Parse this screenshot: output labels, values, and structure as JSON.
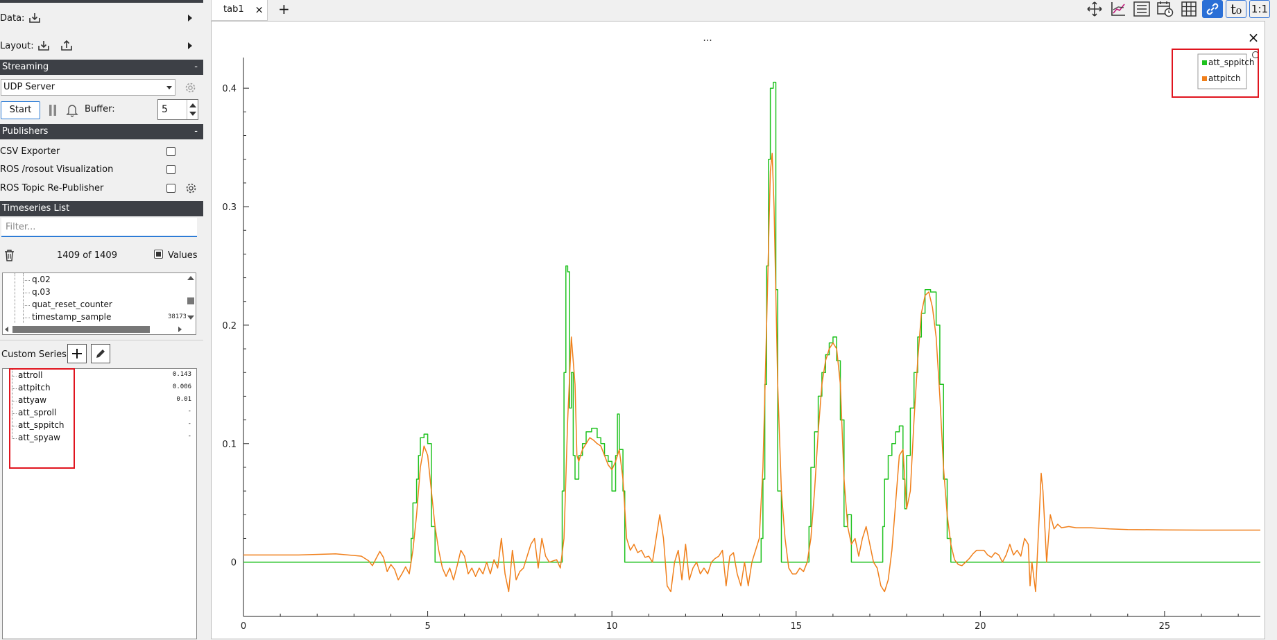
{
  "left": {
    "data_label": "Data:",
    "layout_label": "Layout:",
    "streaming": {
      "header": "Streaming",
      "collapse": "-",
      "source": "UDP Server",
      "start_label": "Start",
      "buffer_label": "Buffer:",
      "buffer_value": "5"
    },
    "publishers": {
      "header": "Publishers",
      "collapse": "-",
      "items": [
        {
          "label": "CSV Exporter"
        },
        {
          "label": "ROS /rosout Visualization"
        },
        {
          "label": "ROS Topic Re-Publisher"
        }
      ]
    },
    "timeseries": {
      "header": "Timeseries List",
      "filter_placeholder": "Filter...",
      "count": "1409 of 1409",
      "values_label": "Values",
      "tree_items": [
        "q.02",
        "q.03",
        "quat_reset_counter",
        "timestamp_sample"
      ],
      "timestamp_value": "38173"
    },
    "custom_series": {
      "label": "Custom Series:",
      "items": [
        {
          "name": "attroll",
          "value": "0.143"
        },
        {
          "name": "attpitch",
          "value": "0.006"
        },
        {
          "name": "attyaw",
          "value": "0.01"
        },
        {
          "name": "att_sproll",
          "value": "-"
        },
        {
          "name": "att_sppitch",
          "value": "-"
        },
        {
          "name": "att_spyaw",
          "value": "-"
        }
      ]
    }
  },
  "tabs": [
    {
      "label": "tab1",
      "close": "×"
    }
  ],
  "add_tab": "+",
  "toolbar": {
    "ratio_label": "1:1",
    "t0_label": "t₀"
  },
  "plot": {
    "title": "...",
    "close": "×"
  },
  "chart_data": {
    "type": "line",
    "xlim": [
      0,
      27.6
    ],
    "ylim": [
      -0.04,
      0.42
    ],
    "xticks": [
      0,
      5,
      10,
      15,
      20,
      25
    ],
    "yticks": [
      0,
      0.1,
      0.2,
      0.3,
      0.4
    ],
    "ytick_labels": [
      "0",
      "0.1",
      "0.2",
      "0.3",
      "0.4"
    ],
    "grid": false,
    "legend_position": "top-right",
    "series": [
      {
        "name": "att_sppitch",
        "color": "#1fc21f",
        "step": true,
        "points": [
          [
            0,
            0
          ],
          [
            4.5,
            0
          ],
          [
            4.55,
            0.02
          ],
          [
            4.6,
            0.05
          ],
          [
            4.7,
            0.07
          ],
          [
            4.75,
            0.09
          ],
          [
            4.8,
            0.105
          ],
          [
            4.9,
            0.108
          ],
          [
            5.0,
            0.1
          ],
          [
            5.1,
            0.03
          ],
          [
            5.2,
            0
          ],
          [
            8.6,
            0
          ],
          [
            8.65,
            0.06
          ],
          [
            8.7,
            0.16
          ],
          [
            8.75,
            0.25
          ],
          [
            8.8,
            0.245
          ],
          [
            8.85,
            0.13
          ],
          [
            8.9,
            0.16
          ],
          [
            8.95,
            0.09
          ],
          [
            9.0,
            0.07
          ],
          [
            9.1,
            0.09
          ],
          [
            9.2,
            0.1
          ],
          [
            9.3,
            0.11
          ],
          [
            9.45,
            0.113
          ],
          [
            9.6,
            0.105
          ],
          [
            9.7,
            0.1
          ],
          [
            9.8,
            0.09
          ],
          [
            9.9,
            0.085
          ],
          [
            10.0,
            0.06
          ],
          [
            10.1,
            0.09
          ],
          [
            10.15,
            0.125
          ],
          [
            10.2,
            0.095
          ],
          [
            10.3,
            0.06
          ],
          [
            10.35,
            0
          ],
          [
            14.0,
            0
          ],
          [
            14.05,
            0.02
          ],
          [
            14.1,
            0.07
          ],
          [
            14.15,
            0.15
          ],
          [
            14.2,
            0.25
          ],
          [
            14.25,
            0.34
          ],
          [
            14.3,
            0.4
          ],
          [
            14.38,
            0.405
          ],
          [
            14.45,
            0.23
          ],
          [
            14.5,
            0.06
          ],
          [
            14.6,
            0
          ],
          [
            15.3,
            0
          ],
          [
            15.35,
            0.03
          ],
          [
            15.4,
            0.08
          ],
          [
            15.5,
            0.11
          ],
          [
            15.6,
            0.14
          ],
          [
            15.7,
            0.16
          ],
          [
            15.8,
            0.175
          ],
          [
            15.9,
            0.185
          ],
          [
            16.0,
            0.19
          ],
          [
            16.1,
            0.17
          ],
          [
            16.2,
            0.12
          ],
          [
            16.3,
            0.03
          ],
          [
            16.4,
            0.04
          ],
          [
            16.5,
            0
          ],
          [
            17.3,
            0
          ],
          [
            17.35,
            0.03
          ],
          [
            17.4,
            0.07
          ],
          [
            17.5,
            0.09
          ],
          [
            17.6,
            0.1
          ],
          [
            17.7,
            0.11
          ],
          [
            17.8,
            0.115
          ],
          [
            17.9,
            0.07
          ],
          [
            17.95,
            0.045
          ],
          [
            18.0,
            0.09
          ],
          [
            18.1,
            0.13
          ],
          [
            18.2,
            0.16
          ],
          [
            18.3,
            0.19
          ],
          [
            18.4,
            0.21
          ],
          [
            18.5,
            0.23
          ],
          [
            18.65,
            0.228
          ],
          [
            18.8,
            0.2
          ],
          [
            18.9,
            0.15
          ],
          [
            19.0,
            0.07
          ],
          [
            19.1,
            0.02
          ],
          [
            19.2,
            0
          ],
          [
            27.6,
            0
          ]
        ]
      },
      {
        "name": "attpitch",
        "color": "#f07f1a",
        "step": false,
        "points": [
          [
            0,
            0.006
          ],
          [
            1.5,
            0.006
          ],
          [
            2.5,
            0.007
          ],
          [
            3.2,
            0.005
          ],
          [
            3.4,
            0.001
          ],
          [
            3.5,
            -0.003
          ],
          [
            3.6,
            0.003
          ],
          [
            3.7,
            0.009
          ],
          [
            3.8,
            0.004
          ],
          [
            3.9,
            -0.008
          ],
          [
            4.0,
            -0.002
          ],
          [
            4.1,
            -0.006
          ],
          [
            4.2,
            -0.015
          ],
          [
            4.3,
            -0.01
          ],
          [
            4.4,
            -0.004
          ],
          [
            4.5,
            -0.01
          ],
          [
            4.6,
            0.01
          ],
          [
            4.7,
            0.04
          ],
          [
            4.8,
            0.08
          ],
          [
            4.9,
            0.098
          ],
          [
            5.0,
            0.09
          ],
          [
            5.1,
            0.06
          ],
          [
            5.2,
            0.03
          ],
          [
            5.3,
            0.01
          ],
          [
            5.4,
            -0.005
          ],
          [
            5.5,
            -0.012
          ],
          [
            5.6,
            -0.005
          ],
          [
            5.7,
            -0.015
          ],
          [
            5.8,
            -0.003
          ],
          [
            5.9,
            0.01
          ],
          [
            6.0,
            0.005
          ],
          [
            6.1,
            -0.01
          ],
          [
            6.2,
            -0.005
          ],
          [
            6.3,
            -0.012
          ],
          [
            6.4,
            -0.005
          ],
          [
            6.5,
            -0.01
          ],
          [
            6.6,
            0.0
          ],
          [
            6.7,
            -0.01
          ],
          [
            6.8,
            0.002
          ],
          [
            6.9,
            -0.005
          ],
          [
            7.0,
            0.02
          ],
          [
            7.1,
            -0.01
          ],
          [
            7.2,
            -0.025
          ],
          [
            7.3,
            0.01
          ],
          [
            7.4,
            -0.015
          ],
          [
            7.5,
            -0.008
          ],
          [
            7.6,
            -0.005
          ],
          [
            7.7,
            0.005
          ],
          [
            7.8,
            0.015
          ],
          [
            7.9,
            0.02
          ],
          [
            8.0,
            -0.005
          ],
          [
            8.1,
            0.02
          ],
          [
            8.2,
            0.005
          ],
          [
            8.3,
            0.0
          ],
          [
            8.5,
            0.002
          ],
          [
            8.6,
            -0.005
          ],
          [
            8.7,
            0.02
          ],
          [
            8.8,
            0.12
          ],
          [
            8.9,
            0.19
          ],
          [
            9.0,
            0.15
          ],
          [
            9.05,
            0.09
          ],
          [
            9.1,
            0.085
          ],
          [
            9.2,
            0.095
          ],
          [
            9.3,
            0.1
          ],
          [
            9.4,
            0.105
          ],
          [
            9.5,
            0.103
          ],
          [
            9.6,
            0.1
          ],
          [
            9.7,
            0.098
          ],
          [
            9.8,
            0.09
          ],
          [
            9.9,
            0.082
          ],
          [
            10.0,
            0.078
          ],
          [
            10.1,
            0.085
          ],
          [
            10.2,
            0.095
          ],
          [
            10.3,
            0.07
          ],
          [
            10.4,
            0.02
          ],
          [
            10.5,
            0.01
          ],
          [
            10.6,
            0.015
          ],
          [
            10.7,
            0.008
          ],
          [
            10.8,
            0.01
          ],
          [
            10.9,
            0.004
          ],
          [
            11.0,
            0.005
          ],
          [
            11.1,
            0.0
          ],
          [
            11.2,
            0.02
          ],
          [
            11.3,
            0.04
          ],
          [
            11.4,
            0.02
          ],
          [
            11.5,
            -0.02
          ],
          [
            11.6,
            -0.025
          ],
          [
            11.7,
            0.0
          ],
          [
            11.8,
            0.01
          ],
          [
            11.9,
            -0.015
          ],
          [
            12.0,
            0.015
          ],
          [
            12.1,
            -0.015
          ],
          [
            12.2,
            -0.005
          ],
          [
            12.3,
            0.0
          ],
          [
            12.4,
            -0.01
          ],
          [
            12.5,
            -0.005
          ],
          [
            12.6,
            -0.01
          ],
          [
            12.7,
            0.0
          ],
          [
            12.8,
            0.003
          ],
          [
            12.9,
            0.005
          ],
          [
            13.0,
            0.01
          ],
          [
            13.1,
            -0.02
          ],
          [
            13.2,
            0.005
          ],
          [
            13.3,
            0.008
          ],
          [
            13.4,
            -0.01
          ],
          [
            13.5,
            -0.02
          ],
          [
            13.6,
            0.0
          ],
          [
            13.7,
            -0.02
          ],
          [
            13.8,
            0.0
          ],
          [
            13.9,
            0.01
          ],
          [
            14.0,
            0.02
          ],
          [
            14.1,
            0.08
          ],
          [
            14.2,
            0.2
          ],
          [
            14.3,
            0.33
          ],
          [
            14.35,
            0.345
          ],
          [
            14.4,
            0.3
          ],
          [
            14.5,
            0.15
          ],
          [
            14.6,
            0.06
          ],
          [
            14.7,
            0.02
          ],
          [
            14.8,
            -0.005
          ],
          [
            14.9,
            -0.01
          ],
          [
            15.0,
            -0.01
          ],
          [
            15.1,
            -0.005
          ],
          [
            15.2,
            -0.008
          ],
          [
            15.3,
            0.0
          ],
          [
            15.4,
            0.02
          ],
          [
            15.5,
            0.06
          ],
          [
            15.6,
            0.11
          ],
          [
            15.7,
            0.15
          ],
          [
            15.8,
            0.17
          ],
          [
            15.9,
            0.18
          ],
          [
            16.0,
            0.185
          ],
          [
            16.1,
            0.18
          ],
          [
            16.2,
            0.15
          ],
          [
            16.3,
            0.07
          ],
          [
            16.4,
            0.03
          ],
          [
            16.5,
            0.015
          ],
          [
            16.6,
            0.02
          ],
          [
            16.7,
            0.005
          ],
          [
            16.8,
            0.02
          ],
          [
            16.9,
            0.03
          ],
          [
            17.0,
            0.015
          ],
          [
            17.1,
            0.0
          ],
          [
            17.2,
            -0.005
          ],
          [
            17.3,
            -0.02
          ],
          [
            17.4,
            -0.025
          ],
          [
            17.5,
            -0.015
          ],
          [
            17.6,
            0.01
          ],
          [
            17.7,
            0.05
          ],
          [
            17.8,
            0.09
          ],
          [
            17.9,
            0.095
          ],
          [
            18.0,
            0.045
          ],
          [
            18.1,
            0.06
          ],
          [
            18.2,
            0.12
          ],
          [
            18.3,
            0.17
          ],
          [
            18.4,
            0.21
          ],
          [
            18.5,
            0.225
          ],
          [
            18.6,
            0.228
          ],
          [
            18.7,
            0.215
          ],
          [
            18.8,
            0.19
          ],
          [
            18.9,
            0.14
          ],
          [
            19.0,
            0.08
          ],
          [
            19.1,
            0.04
          ],
          [
            19.2,
            0.015
          ],
          [
            19.3,
            0.002
          ],
          [
            19.4,
            -0.002
          ],
          [
            19.5,
            -0.003
          ],
          [
            19.6,
            0.0
          ],
          [
            19.7,
            0.003
          ],
          [
            19.8,
            0.007
          ],
          [
            19.9,
            0.01
          ],
          [
            20.0,
            0.01
          ],
          [
            20.1,
            0.01
          ],
          [
            20.2,
            0.006
          ],
          [
            20.3,
            0.004
          ],
          [
            20.4,
            0.008
          ],
          [
            20.5,
            0.006
          ],
          [
            20.6,
            0.0
          ],
          [
            20.7,
            0.006
          ],
          [
            20.8,
            0.015
          ],
          [
            20.9,
            0.006
          ],
          [
            21.0,
            0.01
          ],
          [
            21.1,
            0.005
          ],
          [
            21.2,
            0.02
          ],
          [
            21.3,
            0.015
          ],
          [
            21.35,
            -0.02
          ],
          [
            21.4,
            0.0
          ],
          [
            21.5,
            -0.025
          ],
          [
            21.6,
            0.04
          ],
          [
            21.65,
            0.075
          ],
          [
            21.7,
            0.06
          ],
          [
            21.8,
            0.0
          ],
          [
            21.9,
            0.04
          ],
          [
            22.0,
            0.028
          ],
          [
            22.1,
            0.032
          ],
          [
            22.2,
            0.029
          ],
          [
            22.4,
            0.03
          ],
          [
            22.6,
            0.029
          ],
          [
            23.0,
            0.029
          ],
          [
            23.5,
            0.028
          ],
          [
            24.0,
            0.0275
          ],
          [
            25.0,
            0.0272
          ],
          [
            26.0,
            0.027
          ],
          [
            27.6,
            0.027
          ]
        ]
      }
    ]
  }
}
